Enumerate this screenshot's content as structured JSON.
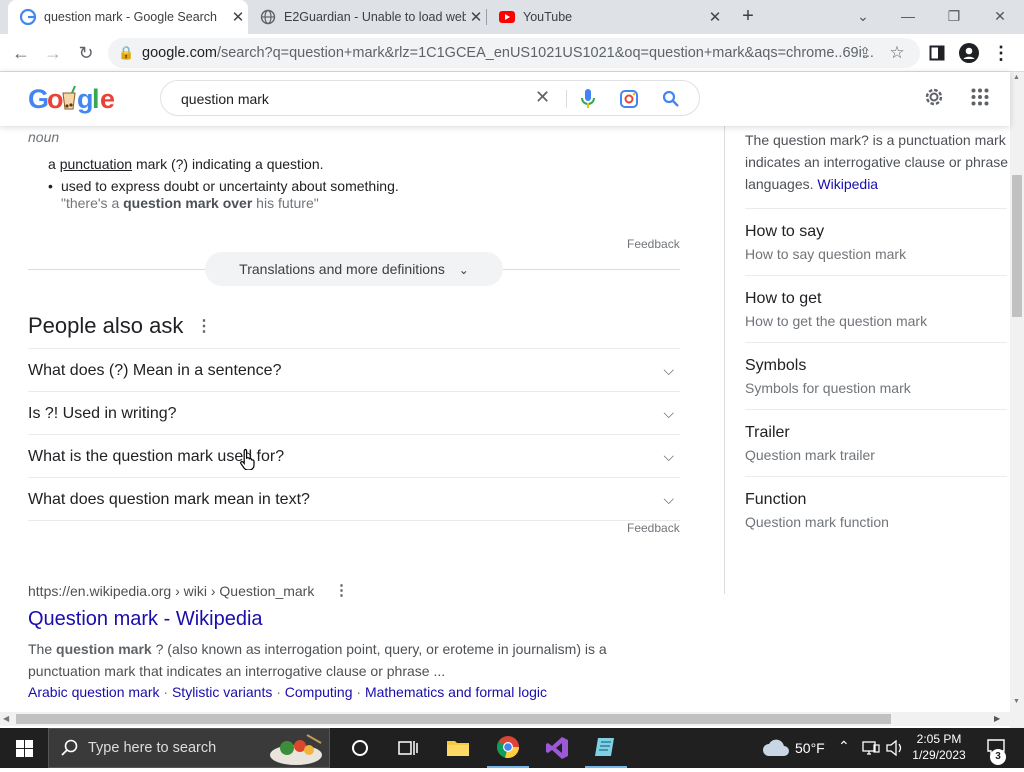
{
  "tabs": [
    {
      "title": "question mark - Google Search",
      "icon": "google-g-icon",
      "active": true
    },
    {
      "title": "E2Guardian - Unable to load web",
      "icon": "globe-icon",
      "active": false
    },
    {
      "title": "YouTube",
      "icon": "youtube-icon",
      "active": false
    }
  ],
  "address": {
    "domain": "google.com",
    "path": "/search?q=question+mark&rlz=1C1GCEA_enUS1021US1021&oq=question+mark&aqs=chrome..69i..."
  },
  "search": {
    "query": "question mark"
  },
  "definition": {
    "pos": "noun",
    "main_prefix": "a ",
    "main_link": "punctuation",
    "main_suffix": " mark (?) indicating a question.",
    "bullet": "used to express doubt or uncertainty about something.",
    "example_a": "\"there's a ",
    "example_b": "question mark over",
    "example_c": " his future\"",
    "feedback": "Feedback",
    "more_button": "Translations and more definitions"
  },
  "paa": {
    "title": "People also ask",
    "questions": [
      "What does (?) Mean in a sentence?",
      "Is ?! Used in writing?",
      "What is the question mark used for?",
      "What does question mark mean in text?"
    ],
    "feedback": "Feedback"
  },
  "result": {
    "url": "https://en.wikipedia.org › wiki › Question_mark",
    "title": "Question mark - Wikipedia",
    "snippet_a": "The ",
    "snippet_b": "question mark",
    "snippet_c": " ? (also known as interrogation point, query, or eroteme in journalism) is a",
    "snippet_line2": "punctuation mark that indicates an interrogative clause or phrase ...",
    "sublinks": [
      "Arabic question mark",
      "Stylistic variants",
      "Computing",
      "Mathematics and formal logic"
    ]
  },
  "side": {
    "desc_line1": "The question mark? is a punctuation mark",
    "desc_line2": "indicates an interrogative clause or phrase",
    "desc_line3": "languages.",
    "desc_link": "Wikipedia",
    "items": [
      {
        "title": "How to say",
        "sub": "How to say question mark"
      },
      {
        "title": "How to get",
        "sub": "How to get the question mark"
      },
      {
        "title": "Symbols",
        "sub": "Symbols for question mark"
      },
      {
        "title": "Trailer",
        "sub": "Question mark trailer"
      },
      {
        "title": "Function",
        "sub": "Question mark function"
      }
    ]
  },
  "taskbar": {
    "search_placeholder": "Type here to search",
    "weather": "50°F",
    "time": "2:05 PM",
    "date": "1/29/2023",
    "notifications": "3"
  },
  "colors": {
    "link": "#1a0dab",
    "accent": "#1a73e8",
    "taskbar": "#202020"
  }
}
